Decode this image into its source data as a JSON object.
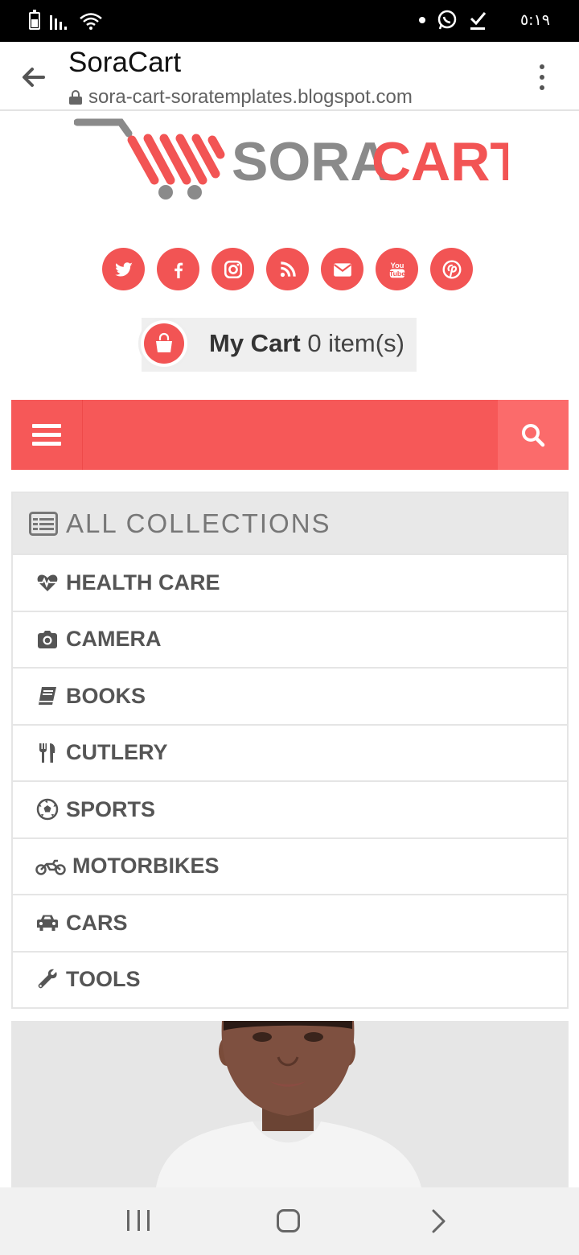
{
  "status_bar": {
    "time": "٥:١٩"
  },
  "browser": {
    "title": "SoraCart",
    "url": "sora-cart-soratemplates.blogspot.com"
  },
  "logo": {
    "part1": "SORA",
    "part2": "CART",
    "color_gray": "#8a8a8a",
    "color_red": "#f25454"
  },
  "social": [
    {
      "icon": "twitter-icon"
    },
    {
      "icon": "facebook-icon"
    },
    {
      "icon": "instagram-icon"
    },
    {
      "icon": "rss-icon"
    },
    {
      "icon": "email-icon"
    },
    {
      "icon": "youtube-icon"
    },
    {
      "icon": "pinterest-icon"
    }
  ],
  "cart": {
    "label": "My Cart",
    "count_text": "0 item(s)"
  },
  "collections": {
    "header": "ALL COLLECTIONS",
    "items": [
      {
        "label": "HEALTH CARE",
        "icon": "heartbeat-icon"
      },
      {
        "label": "CAMERA",
        "icon": "camera-icon"
      },
      {
        "label": "BOOKS",
        "icon": "book-icon"
      },
      {
        "label": "CUTLERY",
        "icon": "cutlery-icon"
      },
      {
        "label": "SPORTS",
        "icon": "soccer-ball-icon"
      },
      {
        "label": "MOTORBIKES",
        "icon": "motorbike-icon"
      },
      {
        "label": "CARS",
        "icon": "car-icon"
      },
      {
        "label": "TOOLS",
        "icon": "wrench-icon"
      }
    ]
  },
  "colors": {
    "accent": "#f65858",
    "accent_light": "#fb6b6b",
    "text_dark": "#555555"
  }
}
